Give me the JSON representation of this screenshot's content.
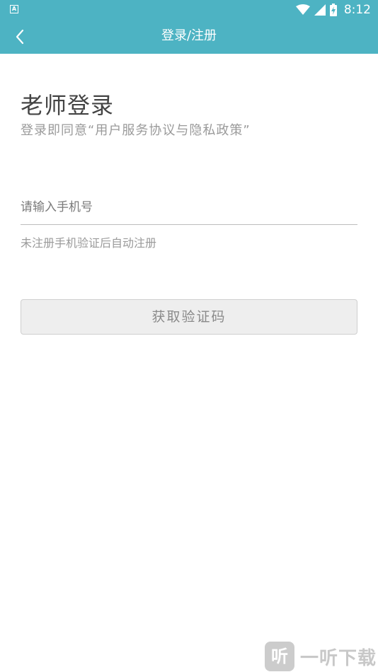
{
  "status_bar": {
    "left_icon": "A",
    "wifi_icon": "wifi-icon",
    "signal_icon": "signal-icon",
    "battery_icon": "battery-charging-icon",
    "time": "8:12"
  },
  "app_bar": {
    "back_icon": "chevron-left-icon",
    "title": "登录/注册",
    "color": "#4db3c3"
  },
  "login": {
    "title": "老师登录",
    "subtitle": "登录即同意“用户服务协议与隐私政策”",
    "phone_placeholder": "请输入手机号",
    "phone_value": "",
    "hint": "未注册手机验证后自动注册",
    "get_code_button": "获取验证码"
  },
  "watermark": {
    "logo_char": "听",
    "text": "一听下载"
  }
}
